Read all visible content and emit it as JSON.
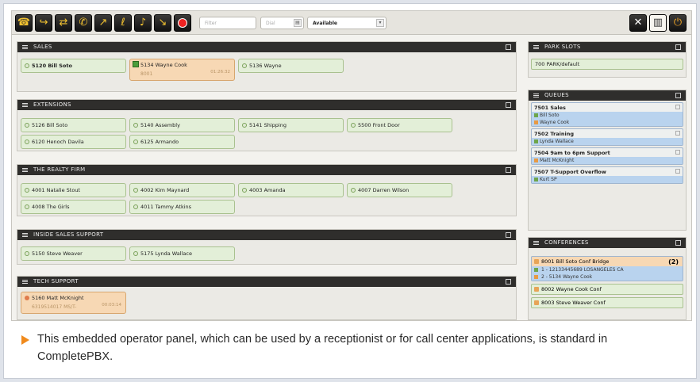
{
  "toolbar": {
    "filter_placeholder": "Filter",
    "dial_placeholder": "Dial",
    "status_value": "Available",
    "left_icons": [
      "phone-icon",
      "transfer-icon",
      "attended-transfer-icon",
      "conference-icon",
      "pickup-icon",
      "listen-icon",
      "whisper-icon",
      "barge-icon",
      "record-icon"
    ],
    "right_icons": [
      "tools-icon",
      "layout-icon",
      "power-icon"
    ]
  },
  "groups": {
    "sales": {
      "title": "SALES",
      "items": [
        {
          "label": "5120 Bill Soto"
        },
        {
          "label": "5134 Wayne Cook",
          "sub": "8001",
          "time": "01:26:32"
        },
        {
          "label": "5136 Wayne"
        }
      ]
    },
    "extensions": {
      "title": "EXTENSIONS",
      "items": [
        {
          "label": "5126 Bill Soto"
        },
        {
          "label": "5140 Assembly"
        },
        {
          "label": "5141 Shipping"
        },
        {
          "label": "5500 Front Door"
        },
        {
          "label": "6120 Henoch Davila"
        },
        {
          "label": "6125 Armando"
        }
      ]
    },
    "realty": {
      "title": "THE REALTY FIRM",
      "items": [
        {
          "label": "4001 Natalie Stout"
        },
        {
          "label": "4002 Kim Maynard"
        },
        {
          "label": "4003 Amanda"
        },
        {
          "label": "4007 Darren Wilson"
        },
        {
          "label": "4008 The Girls"
        },
        {
          "label": "4011 Tammy Atkins"
        }
      ]
    },
    "inside": {
      "title": "INSIDE SALES SUPPORT",
      "items": [
        {
          "label": "5150 Steve Weaver"
        },
        {
          "label": "5175 Lynda Wallace"
        }
      ]
    },
    "tech": {
      "title": "TECH SUPPORT",
      "items": [
        {
          "label": "5160 Matt McKnight",
          "sub": "6319514017 MS/T-",
          "time": "00:03:14"
        }
      ]
    }
  },
  "park": {
    "title": "PARK SLOTS",
    "items": [
      "700 PARK/default"
    ]
  },
  "queues": {
    "title": "QUEUES",
    "items": [
      {
        "name": "7501 Sales",
        "members": [
          "Bill Soto",
          "Wayne Cook"
        ]
      },
      {
        "name": "7502 Training",
        "members": [
          "Lynda Wallace"
        ]
      },
      {
        "name": "7504 9am to 6pm Support",
        "members": [
          "Matt McKnight"
        ]
      },
      {
        "name": "7507 T-Support Overflow",
        "members": [
          "Kurt SP"
        ]
      }
    ]
  },
  "conferences": {
    "title": "CONFERENCES",
    "main": {
      "name": "8001 Bill Soto Conf Bridge",
      "count": "(2)",
      "members": [
        "1 - 12133445689 LOSANGELES CA",
        "2 - 5134 Wayne Cook"
      ]
    },
    "others": [
      "8002 Wayne Cook Conf",
      "8003 Steve Weaver Conf"
    ]
  },
  "caption": "This embedded operator panel, which can be used by a receptionist or for call center applications, is standard in CompletePBX."
}
